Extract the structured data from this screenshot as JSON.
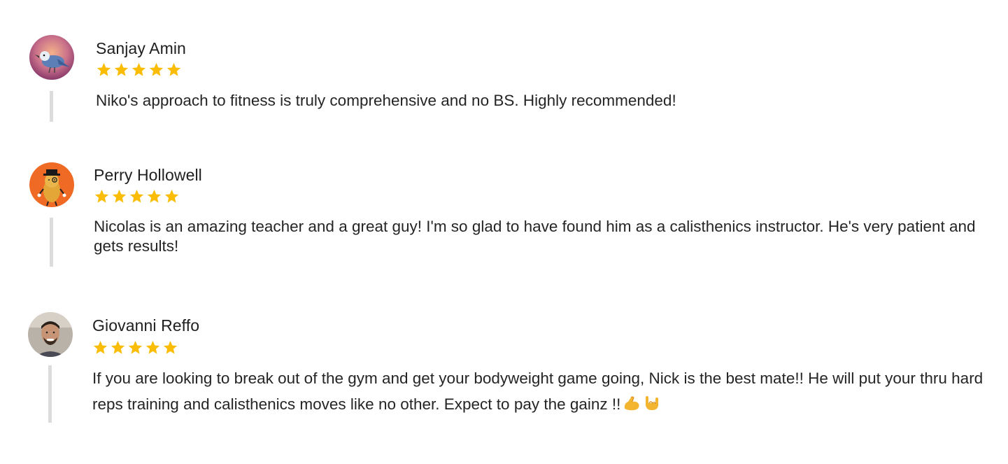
{
  "reviews": [
    {
      "author": "Sanjay Amin",
      "avatar_icon": "bird-avatar-icon",
      "rating": 5,
      "text": "Niko's approach to fitness is truly comprehensive and no BS. Highly recommended!"
    },
    {
      "author": "Perry Hollowell",
      "avatar_icon": "peanut-mascot-avatar-icon",
      "rating": 5,
      "text": "Nicolas is an amazing teacher and a great guy! I'm so glad to have found him as a calisthenics instructor. He's very patient and gets results!"
    },
    {
      "author": "Giovanni Reffo",
      "avatar_icon": "person-photo-avatar-icon",
      "rating": 5,
      "text": "If you are looking to break out of the gym and get your bodyweight game going, Nick is the best mate!! He will put your thru hard reps training and calisthenics moves like no other. Expect to pay the gainz !!",
      "trailing_emojis": [
        "flexed-biceps-emoji",
        "sign-of-the-horns-emoji"
      ]
    }
  ],
  "colors": {
    "star": "#FBBC04",
    "divider": "#DCDCDC",
    "text": "#252525"
  }
}
